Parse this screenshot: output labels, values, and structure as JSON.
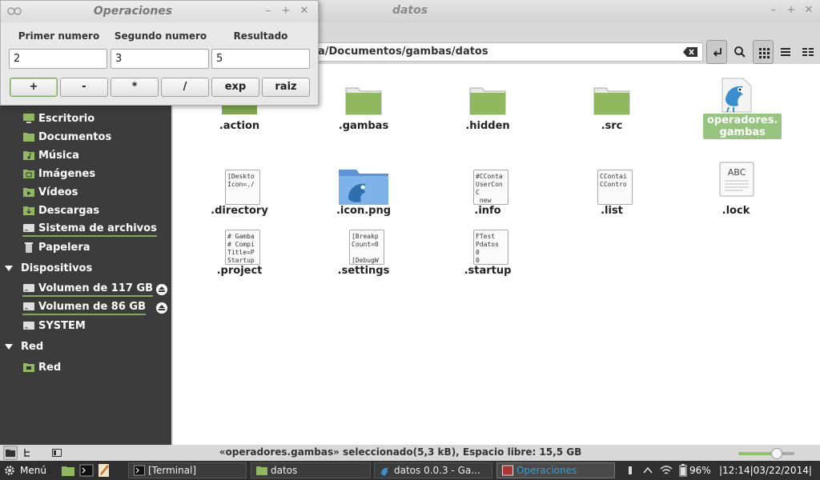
{
  "file_manager": {
    "window_title": "datos",
    "path": "a/Documentos/gambas/datos",
    "status": "«operadores.gambas» seleccionado(5,3 kB), Espacio libre: 15,5 GB",
    "zoom_fraction": 0.68
  },
  "sidebar": {
    "places": [
      {
        "label": "Escritorio",
        "icon": "desktop-icon"
      },
      {
        "label": "Documentos",
        "icon": "folder-icon"
      },
      {
        "label": "Música",
        "icon": "music-folder-icon"
      },
      {
        "label": "Imágenes",
        "icon": "pictures-folder-icon"
      },
      {
        "label": "Vídeos",
        "icon": "video-folder-icon"
      },
      {
        "label": "Descargas",
        "icon": "download-folder-icon"
      },
      {
        "label": "Sistema de archivos",
        "icon": "drive-icon"
      },
      {
        "label": "Papelera",
        "icon": "trash-icon"
      }
    ],
    "devices_header": "Dispositivos",
    "devices": [
      {
        "label": "Volumen de 117 GB"
      },
      {
        "label": "Volumen de 86 GB"
      },
      {
        "label": "SYSTEM"
      }
    ],
    "network_header": "Red",
    "network": [
      {
        "label": "Red"
      }
    ]
  },
  "files": [
    {
      "name": ".action",
      "kind": "folder"
    },
    {
      "name": ".gambas",
      "kind": "folder"
    },
    {
      "name": ".hidden",
      "kind": "folder"
    },
    {
      "name": ".src",
      "kind": "folder"
    },
    {
      "name": "operadores.\ngambas",
      "kind": "gambas",
      "selected": true
    },
    {
      "name": ".directory",
      "kind": "text",
      "preview": "[Deskto\nIcon=./"
    },
    {
      "name": ".icon.png",
      "kind": "image"
    },
    {
      "name": ".info",
      "kind": "text",
      "preview": "#CConta\nUserCon\nC\n new"
    },
    {
      "name": ".list",
      "kind": "text",
      "preview": "CContai\nCContro"
    },
    {
      "name": ".lock",
      "kind": "abc"
    },
    {
      "name": ".project",
      "kind": "text",
      "preview": "# Gamba\n# Compi\nTitle=P\nStartup"
    },
    {
      "name": ".settings",
      "kind": "text",
      "preview": "[Breakp\nCount=0\n\n[DebugW"
    },
    {
      "name": ".startup",
      "kind": "text",
      "preview": "FTest\nPdatos\n0\n0"
    }
  ],
  "calculator": {
    "title": "Operaciones",
    "labels": [
      "Primer numero",
      "Segundo numero",
      "Resultado"
    ],
    "inputs": {
      "first": "2",
      "second": "3",
      "result": "5"
    },
    "buttons": [
      "+",
      "-",
      "*",
      "/",
      "exp",
      "raiz"
    ]
  },
  "panel": {
    "menu_label": "Menú",
    "tasks": [
      {
        "label": "[Terminal]"
      },
      {
        "label": "datos"
      },
      {
        "label": "datos 0.0.3 - Ga..."
      },
      {
        "label": "Operaciones"
      }
    ],
    "battery": "96%",
    "clock": "|12:14|03/22/2014|"
  },
  "colors": {
    "accent": "#7faa5a",
    "folder_green": "#8fb85f",
    "sidebar_bg": "#3c3c3c"
  }
}
